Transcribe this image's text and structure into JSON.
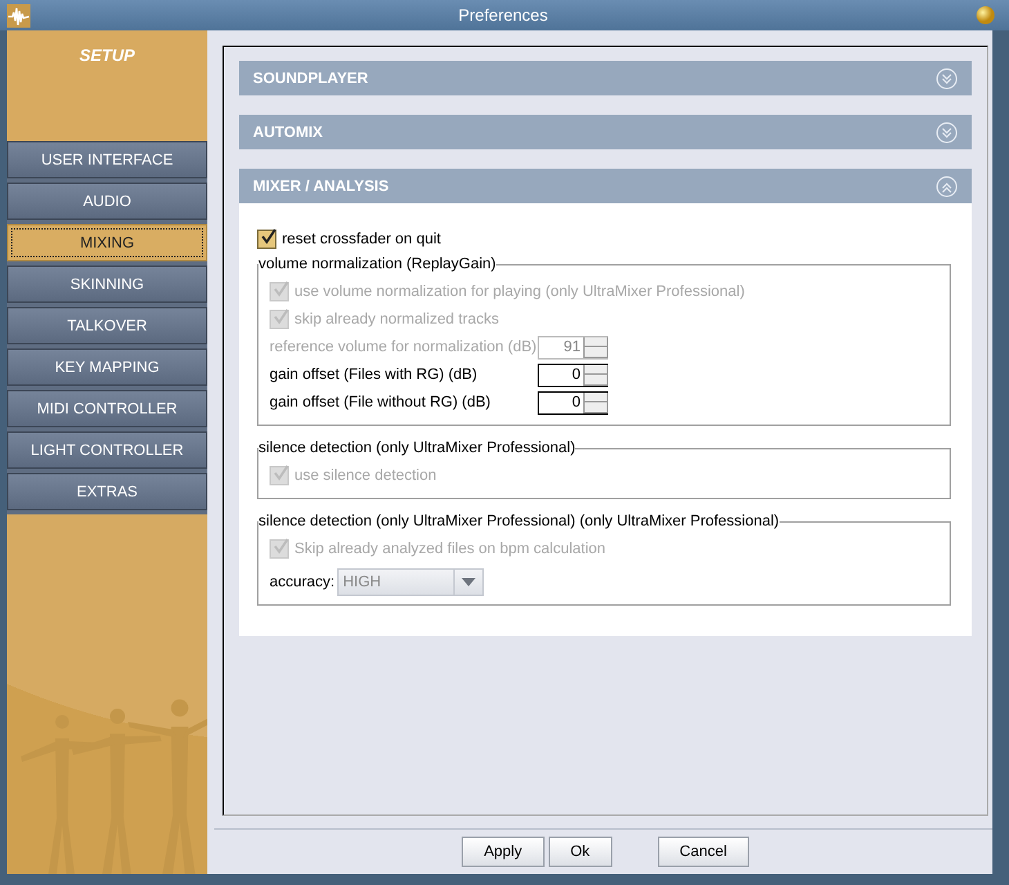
{
  "window": {
    "title": "Preferences"
  },
  "sidebar": {
    "title": "SETUP",
    "items": [
      {
        "label": "USER INTERFACE",
        "selected": false
      },
      {
        "label": "AUDIO",
        "selected": false
      },
      {
        "label": "MIXING",
        "selected": true
      },
      {
        "label": "SKINNING",
        "selected": false
      },
      {
        "label": "TALKOVER",
        "selected": false
      },
      {
        "label": "KEY MAPPING",
        "selected": false
      },
      {
        "label": "MIDI CONTROLLER",
        "selected": false
      },
      {
        "label": "LIGHT CONTROLLER",
        "selected": false
      },
      {
        "label": "EXTRAS",
        "selected": false
      }
    ]
  },
  "sections": [
    {
      "title": "SOUNDPLAYER",
      "expanded": false
    },
    {
      "title": "AUTOMIX",
      "expanded": false
    },
    {
      "title": "MIXER / ANALYSIS",
      "expanded": true,
      "items": [
        {
          "kind": "checkbox",
          "label": "reset crossfader on quit",
          "checked": true,
          "disabled": false
        },
        {
          "kind": "group",
          "title": "volume normalization (ReplayGain)",
          "items": [
            {
              "kind": "checkbox",
              "label": "use volume normalization for playing (only UltraMixer Professional)",
              "checked": true,
              "disabled": true
            },
            {
              "kind": "checkbox",
              "label": "skip already normalized tracks",
              "checked": true,
              "disabled": true
            },
            {
              "kind": "spinner",
              "label": "reference volume for normalization (dB)",
              "value": "91",
              "disabled": true
            },
            {
              "kind": "spinner",
              "label": "gain offset (Files with RG) (dB)",
              "value": "0",
              "disabled": false
            },
            {
              "kind": "spinner",
              "label": "gain offset (File without RG) (dB)",
              "value": "0",
              "disabled": false
            }
          ]
        },
        {
          "kind": "group",
          "title": "silence detection (only UltraMixer Professional)",
          "items": [
            {
              "kind": "checkbox",
              "label": "use silence detection",
              "checked": true,
              "disabled": true
            }
          ]
        },
        {
          "kind": "group",
          "title": "silence detection (only UltraMixer Professional) (only UltraMixer Professional)",
          "items": [
            {
              "kind": "checkbox",
              "label": "Skip already analyzed files on bpm calculation",
              "checked": true,
              "disabled": true
            },
            {
              "kind": "combo",
              "label": "accuracy:",
              "value": "HIGH",
              "disabled": true
            }
          ]
        }
      ]
    }
  ],
  "buttons": [
    {
      "label": "Apply"
    },
    {
      "label": "Ok"
    },
    {
      "label": "Cancel"
    }
  ]
}
